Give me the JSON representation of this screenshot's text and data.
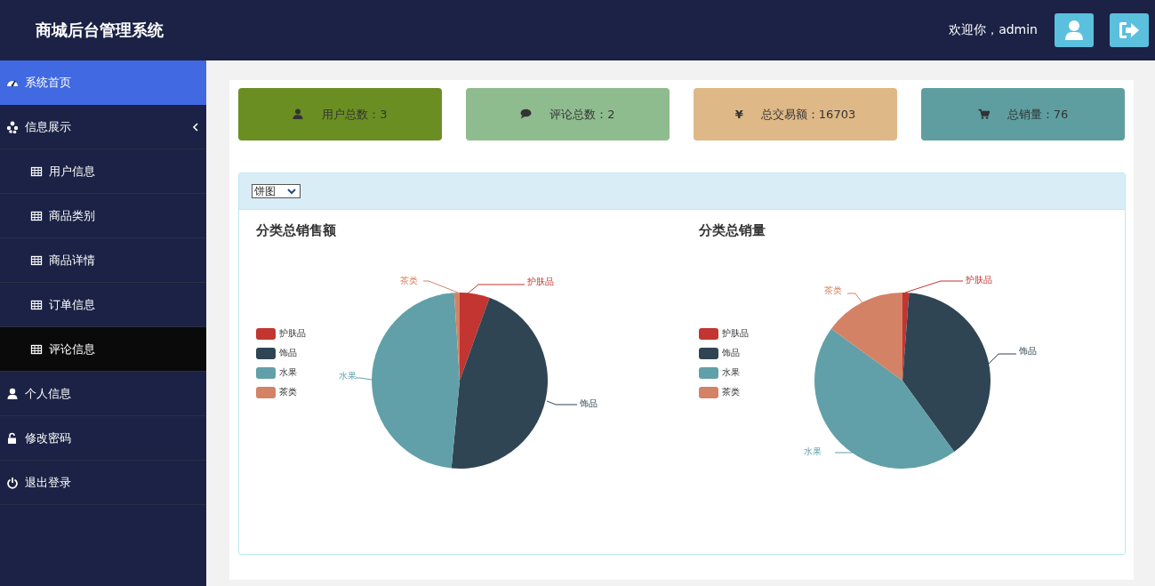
{
  "header": {
    "title": "商城后台管理系统",
    "welcome": "欢迎你，admin"
  },
  "sidebar": {
    "items": [
      {
        "label": "系统首页",
        "selected": true
      },
      {
        "label": "信息展示",
        "selected": false,
        "expanded": true,
        "children": [
          {
            "label": "用户信息",
            "selected": false
          },
          {
            "label": "商品类别",
            "selected": false
          },
          {
            "label": "商品详情",
            "selected": false
          },
          {
            "label": "订单信息",
            "selected": false
          },
          {
            "label": "评论信息",
            "selected": true
          }
        ]
      },
      {
        "label": "个人信息",
        "selected": false
      },
      {
        "label": "修改密码",
        "selected": false
      },
      {
        "label": "退出登录",
        "selected": false
      }
    ]
  },
  "stats": [
    {
      "label": "用户总数：3",
      "color": "#6b8e23"
    },
    {
      "label": "评论总数：2",
      "color": "#8fbc8f"
    },
    {
      "label": "总交易额：16703",
      "color": "#deb887",
      "symbol": "¥"
    },
    {
      "label": "总销量：76",
      "color": "#5f9ea0"
    }
  ],
  "chart_panel": {
    "select": {
      "value": "饼图"
    },
    "charts": [
      {
        "title": "分类总销售额",
        "legend": [
          {
            "name": "护肤品",
            "color": "#c23531"
          },
          {
            "name": "饰品",
            "color": "#2f4554"
          },
          {
            "name": "水果",
            "color": "#61a0a8"
          },
          {
            "name": "茶类",
            "color": "#d48265"
          }
        ],
        "slice_labels": [
          "护肤品",
          "饰品",
          "水果",
          "茶类"
        ]
      },
      {
        "title": "分类总销量",
        "legend": [
          {
            "name": "护肤品",
            "color": "#c23531"
          },
          {
            "name": "饰品",
            "color": "#2f4554"
          },
          {
            "name": "水果",
            "color": "#61a0a8"
          },
          {
            "name": "茶类",
            "color": "#d48265"
          }
        ],
        "slice_labels": [
          "护肤品",
          "饰品",
          "水果",
          "茶类"
        ]
      }
    ]
  }
}
